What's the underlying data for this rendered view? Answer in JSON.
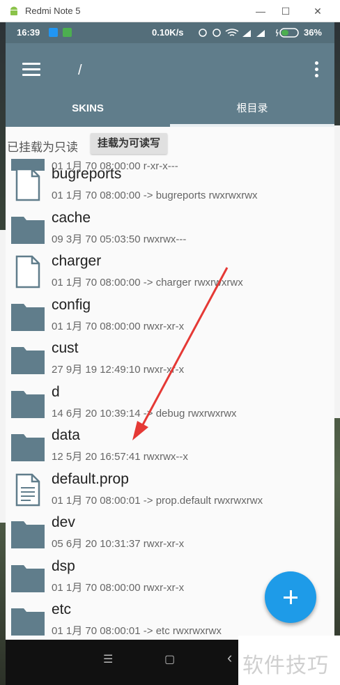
{
  "window": {
    "title": "Redmi Note 5",
    "minimize": "—",
    "maximize": "☐",
    "close": "✕"
  },
  "status": {
    "time": "16:39",
    "speed": "0.10K/s",
    "battery": "36%"
  },
  "appbar": {
    "path": "/",
    "tabs": [
      "SKINS",
      "根目录"
    ],
    "active_tab": 1
  },
  "mount": {
    "readonly_label": "已挂载为只读",
    "rw_button": "挂载为可读写"
  },
  "partial_row": {
    "meta": "01 1月 70 08:00:00    r-xr-x---"
  },
  "files": [
    {
      "name": "bugreports",
      "meta": "01 1月 70 08:00:00  -> bugreports  rwxrwxrwx",
      "type": "file"
    },
    {
      "name": "cache",
      "meta": "09 3月 70 05:03:50    rwxrwx---",
      "type": "folder"
    },
    {
      "name": "charger",
      "meta": "01 1月 70 08:00:00  -> charger  rwxrwxrwx",
      "type": "file"
    },
    {
      "name": "config",
      "meta": "01 1月 70 08:00:00    rwxr-xr-x",
      "type": "folder"
    },
    {
      "name": "cust",
      "meta": "27 9月 19 12:49:10    rwxr-xr-x",
      "type": "folder"
    },
    {
      "name": "d",
      "meta": "14 6月 20 10:39:14  -> debug  rwxrwxrwx",
      "type": "folder"
    },
    {
      "name": "data",
      "meta": "12 5月 20 16:57:41    rwxrwx--x",
      "type": "folder"
    },
    {
      "name": "default.prop",
      "meta": "01 1月 70 08:00:01  -> prop.default  rwxrwxrwx",
      "type": "doc"
    },
    {
      "name": "dev",
      "meta": "05 6月 20 10:31:37    rwxr-xr-x",
      "type": "folder"
    },
    {
      "name": "dsp",
      "meta": "01 1月 70 08:00:00    rwxr-xr-x",
      "type": "folder"
    },
    {
      "name": "etc",
      "meta": "01 1月 70 08:00:01  -> etc  rwxrwxrwx",
      "type": "folder"
    }
  ],
  "fab": {
    "symbol": "+"
  },
  "navbar": {
    "menu": "☰",
    "home": "▢",
    "back": "‹"
  },
  "watermark": "软件技巧",
  "colors": {
    "appbar": "#607d8b",
    "statusbar": "#546e7a",
    "icon": "#607d8b",
    "fab": "#1e9be8",
    "arrow": "#e53935"
  }
}
